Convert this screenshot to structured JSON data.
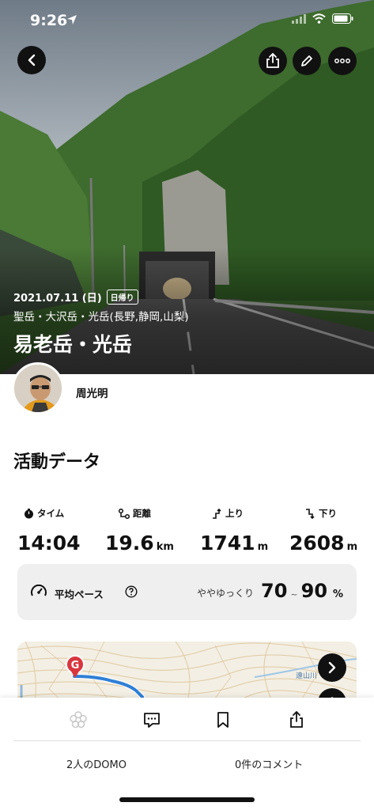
{
  "status_bar": {
    "time": "9:26"
  },
  "header": {
    "back_icon": "chevron-left-icon",
    "share_icon": "share-icon",
    "edit_icon": "pencil-icon",
    "more_icon": "more-icon"
  },
  "activity": {
    "date": "2021.07.11 (日)",
    "day_badge": "日帰り",
    "route": "聖岳・大沢岳・光岳(長野,静岡,山梨)",
    "title": "易老岳・光岳",
    "user_name": "周光明"
  },
  "section_title": "活動データ",
  "stats": {
    "time": {
      "label": "タイム",
      "value": "14:04"
    },
    "distance": {
      "label": "距離",
      "value": "19.6",
      "unit": "km"
    },
    "ascent": {
      "label": "上り",
      "value": "1741",
      "unit": "m"
    },
    "descent": {
      "label": "下り",
      "value": "2608",
      "unit": "m"
    }
  },
  "pace": {
    "label": "平均ペース",
    "description": "ややゆっくり",
    "low": "70",
    "tilde": "~",
    "high": "90",
    "unit": "%"
  },
  "map": {
    "goal_marker": "G",
    "river_label": "遠山川"
  },
  "bottom": {
    "domo_count": "2人のDOMO",
    "comment_count": "0件のコメント"
  },
  "colors": {
    "accent_red": "#d9363e",
    "route_blue": "#2f7fd6",
    "card_bg": "#efefef"
  }
}
